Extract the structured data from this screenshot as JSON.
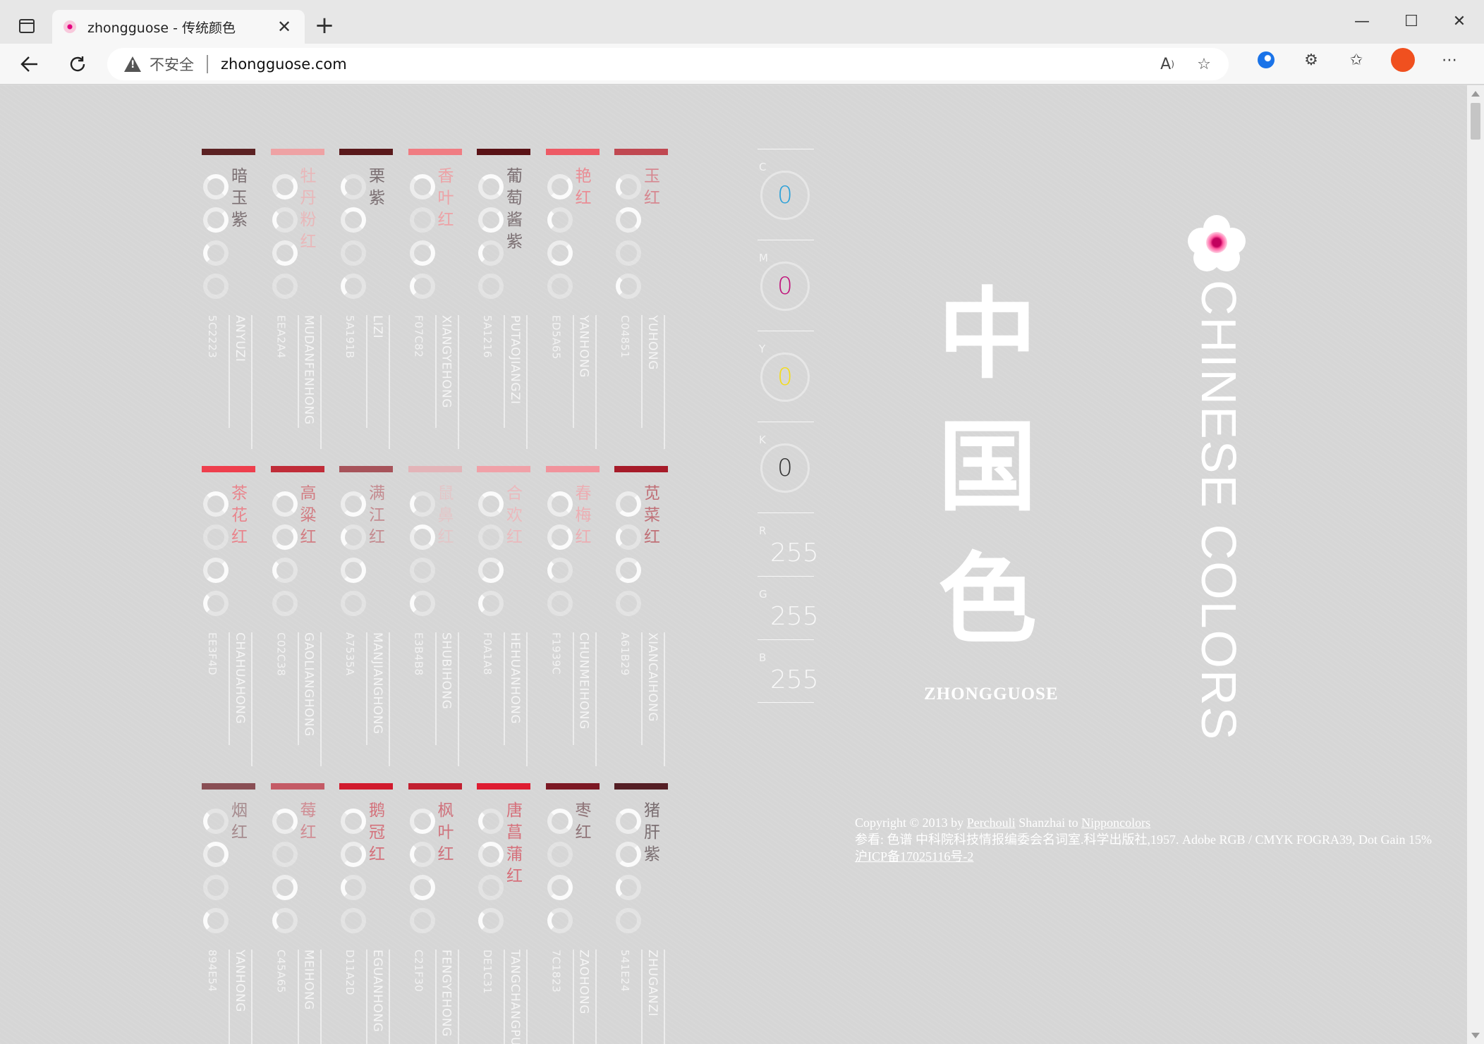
{
  "browser": {
    "tab_title": "zhongguose  -  传统颜色",
    "new_tab": "+",
    "insecure_label": "不安全",
    "url": "zhongguose.com",
    "window": {
      "minimize": "—",
      "maximize": "☐",
      "close": "✕"
    }
  },
  "cards": [
    {
      "name": "暗玉紫",
      "pinyin": "ANYUZI",
      "hex": "5C2223",
      "color": "#5c2223",
      "text_color": "#7b6f72"
    },
    {
      "name": "牡丹粉红",
      "pinyin": "MUDANFENHONG",
      "hex": "EEA2A4",
      "color": "#eea2a4",
      "text_color": "#e9b7b9"
    },
    {
      "name": "栗紫",
      "pinyin": "LIZI",
      "hex": "5A191B",
      "color": "#5a191b",
      "text_color": "#7b6f72"
    },
    {
      "name": "香叶红",
      "pinyin": "XIANGYEHONG",
      "hex": "F07C82",
      "color": "#f07c82",
      "text_color": "#eda2a6"
    },
    {
      "name": "葡萄酱紫",
      "pinyin": "PUTAOJIANGZI",
      "hex": "5A1216",
      "color": "#5a1216",
      "text_color": "#7b6f72"
    },
    {
      "name": "艳红",
      "pinyin": "YANHONG",
      "hex": "ED5A65",
      "color": "#ed5a65",
      "text_color": "#ea8c94"
    },
    {
      "name": "玉红",
      "pinyin": "YUHONG",
      "hex": "C04851",
      "color": "#c04851",
      "text_color": "#d68790"
    },
    {
      "name": "茶花红",
      "pinyin": "CHAHUAHONG",
      "hex": "EE3F4D",
      "color": "#ee3f4d",
      "text_color": "#e9848c"
    },
    {
      "name": "高粱红",
      "pinyin": "GAOLIANGHONG",
      "hex": "C02C38",
      "color": "#c02c38",
      "text_color": "#d27d83"
    },
    {
      "name": "满江红",
      "pinyin": "MANJIANGHONG",
      "hex": "A7535A",
      "color": "#a7535a",
      "text_color": "#c48b90"
    },
    {
      "name": "鼠鼻红",
      "pinyin": "SHUBIHONG",
      "hex": "E3B4B8",
      "color": "#e3b4b8",
      "text_color": "#e3c6c8"
    },
    {
      "name": "合欢红",
      "pinyin": "HEHUANHONG",
      "hex": "F0A1A8",
      "color": "#f0a1a8",
      "text_color": "#ebb9bd"
    },
    {
      "name": "春梅红",
      "pinyin": "CHUNMEIHONG",
      "hex": "F1939C",
      "color": "#f1939c",
      "text_color": "#ecaeb3"
    },
    {
      "name": "苋菜红",
      "pinyin": "XIANCAIHONG",
      "hex": "A61B29",
      "color": "#a61b29",
      "text_color": "#c07077"
    },
    {
      "name": "烟红",
      "pinyin": "YANHONG",
      "hex": "894E54",
      "color": "#894e54",
      "text_color": "#a58a8d"
    },
    {
      "name": "莓红",
      "pinyin": "MEIHONG",
      "hex": "C45A65",
      "color": "#c45a65",
      "text_color": "#d08c93"
    },
    {
      "name": "鹅冠红",
      "pinyin": "EGUANHONG",
      "hex": "D11A2D",
      "color": "#d11a2d",
      "text_color": "#d4707a"
    },
    {
      "name": "枫叶红",
      "pinyin": "FENGYEHONG",
      "hex": "C21F30",
      "color": "#c21f30",
      "text_color": "#cf727c"
    },
    {
      "name": "唐菖蒲红",
      "pinyin": "TANGCHANGPUHONG",
      "hex": "DE1C31",
      "color": "#de1c31",
      "text_color": "#d6707b"
    },
    {
      "name": "枣红",
      "pinyin": "ZAOHONG",
      "hex": "7C1823",
      "color": "#7c1823",
      "text_color": "#8f7478"
    },
    {
      "name": "猪肝紫",
      "pinyin": "ZHUGANZI",
      "hex": "541E24",
      "color": "#541e24",
      "text_color": "#7b6f72"
    }
  ],
  "panel": {
    "c_label": "C",
    "c_value": "0",
    "c_color": "#2aa0d8",
    "m_label": "M",
    "m_value": "0",
    "m_color": "#c0127a",
    "y_label": "Y",
    "y_value": "0",
    "y_color": "#f4dc1a",
    "k_label": "K",
    "k_value": "0",
    "k_color": "#333333",
    "r_label": "R",
    "r_value": "255",
    "g_label": "G",
    "g_value": "255",
    "b_label": "B",
    "b_value": "255"
  },
  "title": {
    "char1": "中",
    "char2": "国",
    "char3": "色",
    "subtitle": "ZHONGGUOSE",
    "english": "CHINESE COLORS"
  },
  "footer": {
    "copyright": "Copyright © 2013 by ",
    "author": "Perchouli",
    "shanzhai": " Shanzhai to ",
    "nippon": "Nipponcolors",
    "reference": "参看: 色谱 中科院科技情报编委会名词室.科学出版社,1957. Adobe RGB / CMYK FOGRA39, Dot Gain 15%",
    "icp": "沪ICP备17025116号-2"
  }
}
